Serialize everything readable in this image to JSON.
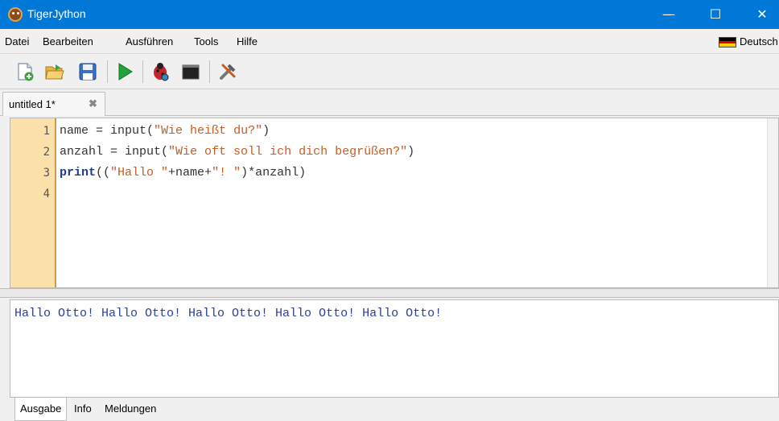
{
  "window": {
    "title": "TigerJython",
    "minimize_glyph": "—",
    "maximize_glyph": "☐",
    "close_glyph": "✕"
  },
  "menu": {
    "items": [
      "Datei",
      "Bearbeiten",
      "Ausführen",
      "Tools",
      "Hilfe"
    ],
    "language": "Deutsch"
  },
  "toolbar": {
    "icons": [
      "new-file-icon",
      "open-file-icon",
      "save-icon",
      "run-icon",
      "debug-icon",
      "console-icon",
      "tools-icon"
    ]
  },
  "tabs": {
    "document": "untitled 1*",
    "close_glyph": "✖"
  },
  "editor": {
    "line_numbers": [
      "1",
      "2",
      "3",
      "4"
    ],
    "lines": [
      [
        {
          "t": "name = ",
          "k": "plain"
        },
        {
          "t": "input",
          "k": "plain"
        },
        {
          "t": "(",
          "k": "plain"
        },
        {
          "t": "\"Wie heißt du?\"",
          "k": "str"
        },
        {
          "t": ")",
          "k": "plain"
        }
      ],
      [
        {
          "t": "anzahl = ",
          "k": "plain"
        },
        {
          "t": "input",
          "k": "plain"
        },
        {
          "t": "(",
          "k": "plain"
        },
        {
          "t": "\"Wie oft soll ich dich begrüßen?\"",
          "k": "str"
        },
        {
          "t": ")",
          "k": "plain"
        }
      ],
      [
        {
          "t": "print",
          "k": "kw"
        },
        {
          "t": "((",
          "k": "plain"
        },
        {
          "t": "\"Hallo \"",
          "k": "str"
        },
        {
          "t": "+name+",
          "k": "plain"
        },
        {
          "t": "\"! \"",
          "k": "str"
        },
        {
          "t": ")*anzahl)",
          "k": "plain"
        }
      ],
      []
    ]
  },
  "output": {
    "text": "Hallo Otto! Hallo Otto! Hallo Otto! Hallo Otto! Hallo Otto!"
  },
  "bottom_tabs": [
    "Ausgabe",
    "Info",
    "Meldungen"
  ],
  "colors": {
    "titlebar": "#0078d7",
    "gutter": "#fce0aa",
    "string": "#c65c21",
    "keyword": "#1f3c8a",
    "output_text": "#2a3f9a"
  }
}
